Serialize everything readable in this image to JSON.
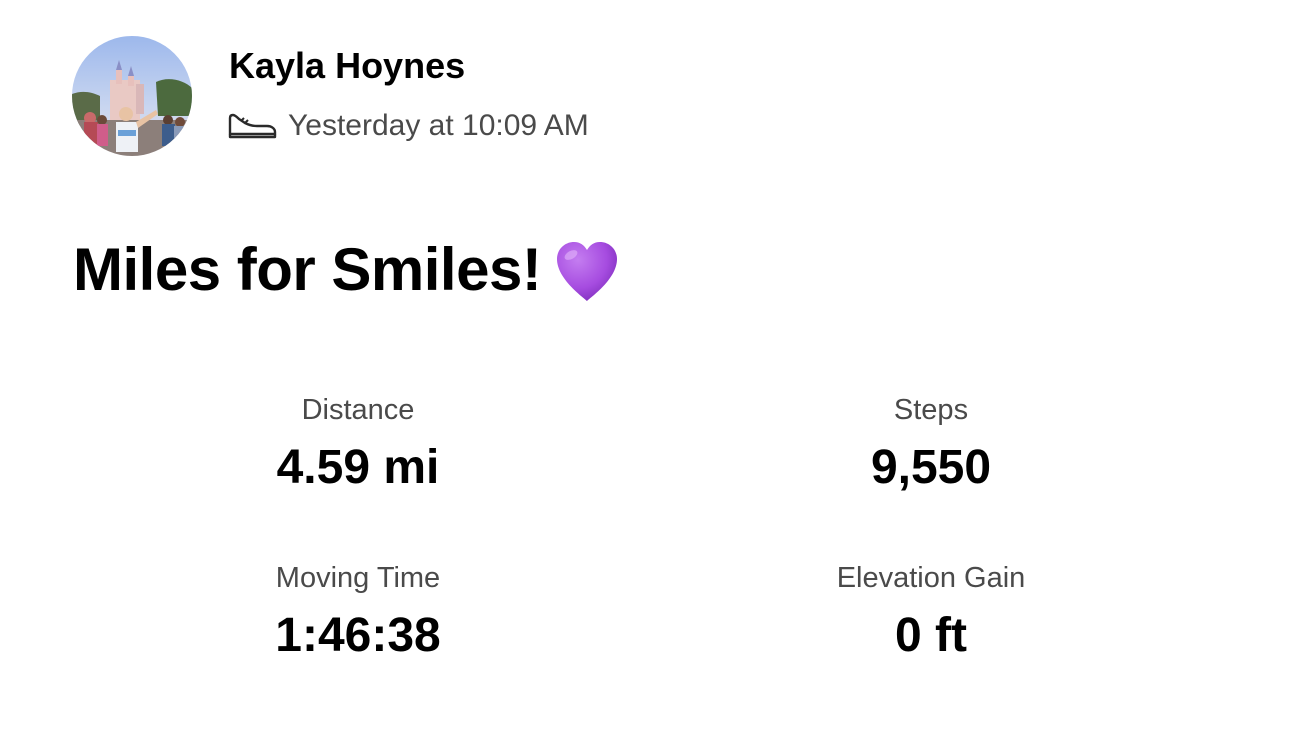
{
  "header": {
    "athlete_name": "Kayla Hoynes",
    "timestamp": "Yesterday at 10:09 AM",
    "activity_type_icon": "shoe-icon",
    "avatar_icon": "avatar-photo"
  },
  "activity": {
    "title": "Miles for Smiles!",
    "title_emoji_icon": "purple-heart-icon",
    "emoji_color": "#a64ce0"
  },
  "stats": {
    "distance": {
      "label": "Distance",
      "value": "4.59 mi"
    },
    "steps": {
      "label": "Steps",
      "value": "9,550"
    },
    "moving_time": {
      "label": "Moving Time",
      "value": "1:46:38"
    },
    "elevation_gain": {
      "label": "Elevation Gain",
      "value": "0 ft"
    }
  },
  "colors": {
    "primary_text": "#000000",
    "secondary_text": "#4a4a4a",
    "background": "#ffffff"
  }
}
